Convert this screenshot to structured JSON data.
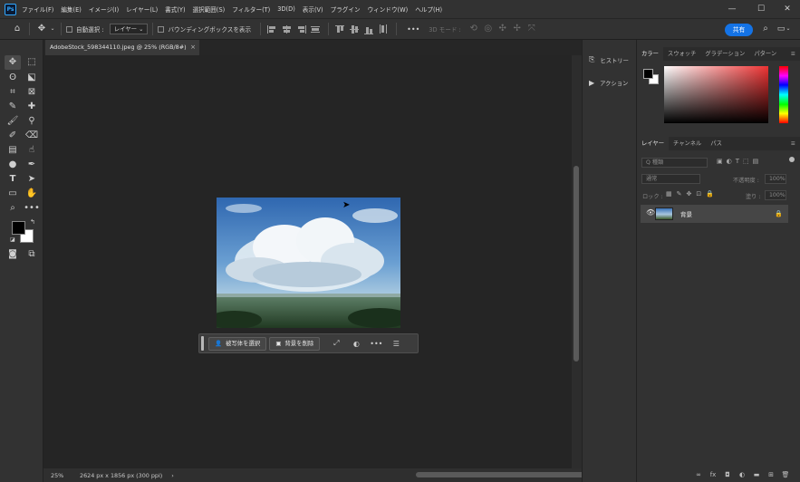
{
  "app": {
    "logo": "Ps"
  },
  "menu": [
    "ファイル(F)",
    "編集(E)",
    "イメージ(I)",
    "レイヤー(L)",
    "書式(Y)",
    "選択範囲(S)",
    "フィルター(T)",
    "3D(D)",
    "表示(V)",
    "プラグイン",
    "ウィンドウ(W)",
    "ヘルプ(H)"
  ],
  "window_controls": {
    "minimize": "—",
    "maximize": "☐",
    "close": "✕"
  },
  "options": {
    "home_icon": "home-icon",
    "auto_select_label": "自動選択 :",
    "auto_select_value": "レイヤー",
    "bounding_box_label": "バウンディングボックスを表示",
    "more": "•••",
    "mode_3d": "3D モード :",
    "share": "共有"
  },
  "document": {
    "tab_title": "AdobeStock_598344110.jpeg @ 25% (RGB/8#)",
    "tab_close": "×"
  },
  "status": {
    "zoom": "25%",
    "dimensions": "2624 px x 1856 px (300 ppi)",
    "arrow": "›"
  },
  "contextual_bar": {
    "select_subject": "被写体を選択",
    "remove_background": "背景を削除",
    "more": "•••"
  },
  "mid_panel": {
    "history": "ヒストリー",
    "actions": "アクション"
  },
  "color_panel": {
    "tabs": [
      "カラー",
      "スウォッチ",
      "グラデーション",
      "パターン"
    ],
    "foreground": "#000000",
    "background": "#ffffff"
  },
  "layers_panel": {
    "tabs": [
      "レイヤー",
      "チャンネル",
      "パス"
    ],
    "kind_placeholder": "Q 種類",
    "blend_mode": "通常",
    "opacity_label": "不透明度 :",
    "opacity_value": "100%",
    "lock_label": "ロック :",
    "fill_label": "塗り :",
    "fill_value": "100%",
    "layer_name": "背景"
  },
  "colors": {
    "accent": "#1473e6",
    "ui_bg": "#323232",
    "canvas_bg": "#252525"
  }
}
